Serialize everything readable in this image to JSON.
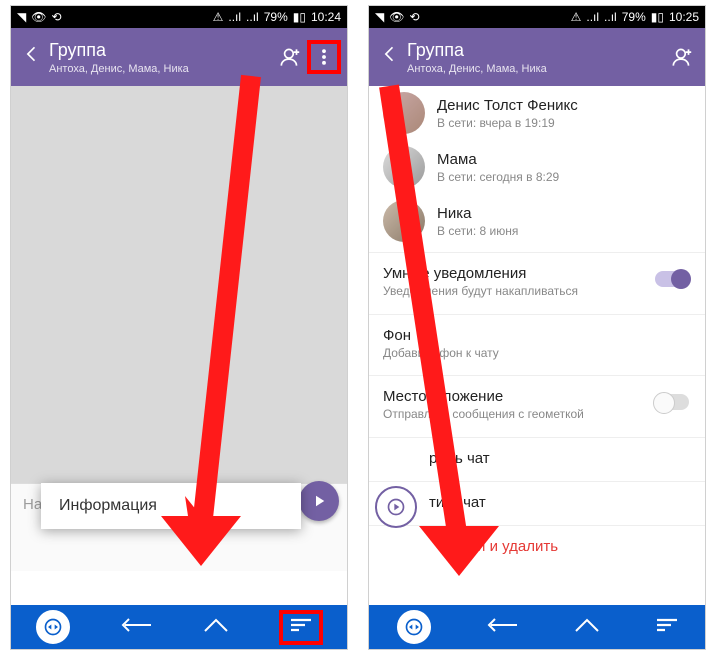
{
  "statusbar": {
    "battery": "79%",
    "time_left": "10:24",
    "time_right": "10:25"
  },
  "appbar": {
    "title": "Группа",
    "subtitle": "Антоха, Денис, Мама, Ника"
  },
  "compose": {
    "placeholder": "Напишите сообщение…"
  },
  "popup": {
    "info": "Информация"
  },
  "members": [
    {
      "name": "Денис Толст Феникс",
      "status": "В сети: вчера в 19:19"
    },
    {
      "name": "Мама",
      "status": "В сети: сегодня в 8:29"
    },
    {
      "name": "Ника",
      "status": "В сети: 8 июня"
    }
  ],
  "options": {
    "smart_title": "Умные уведомления",
    "smart_sub": "Уведомления будут накапливаться",
    "bg_title": "Фон",
    "bg_sub": "Добавить фон к чату",
    "loc_title": "Местоположение",
    "loc_sub": "Отправлять сообщения с геометкой",
    "hide": "рыть чат",
    "clear": "тить чат",
    "leave": "Выйти и удалить"
  }
}
